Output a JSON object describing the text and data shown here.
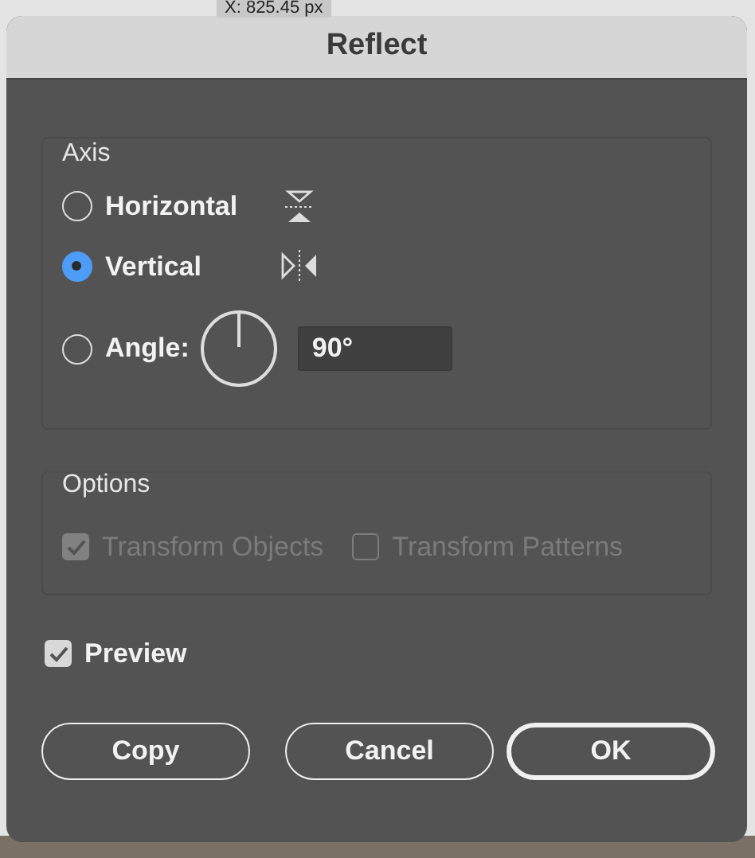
{
  "tooltip": {
    "text": "X: 825.45 px"
  },
  "window": {
    "title": "Reflect"
  },
  "axis": {
    "title": "Axis",
    "options": [
      {
        "kind": "horizontal",
        "label": "Horizontal",
        "selected": false
      },
      {
        "kind": "vertical",
        "label": "Vertical",
        "selected": true
      },
      {
        "kind": "angle",
        "label": "Angle:",
        "selected": false,
        "value": "90°"
      }
    ]
  },
  "options": {
    "title": "Options",
    "checkboxes": [
      {
        "label": "Transform Objects",
        "checked": true,
        "disabled": true
      },
      {
        "label": "Transform Patterns",
        "checked": false,
        "disabled": true
      }
    ]
  },
  "preview": {
    "label": "Preview",
    "checked": true
  },
  "buttons": [
    {
      "label": "Copy",
      "default": false
    },
    {
      "label": "Cancel",
      "default": false
    },
    {
      "label": "OK",
      "default": true
    }
  ]
}
